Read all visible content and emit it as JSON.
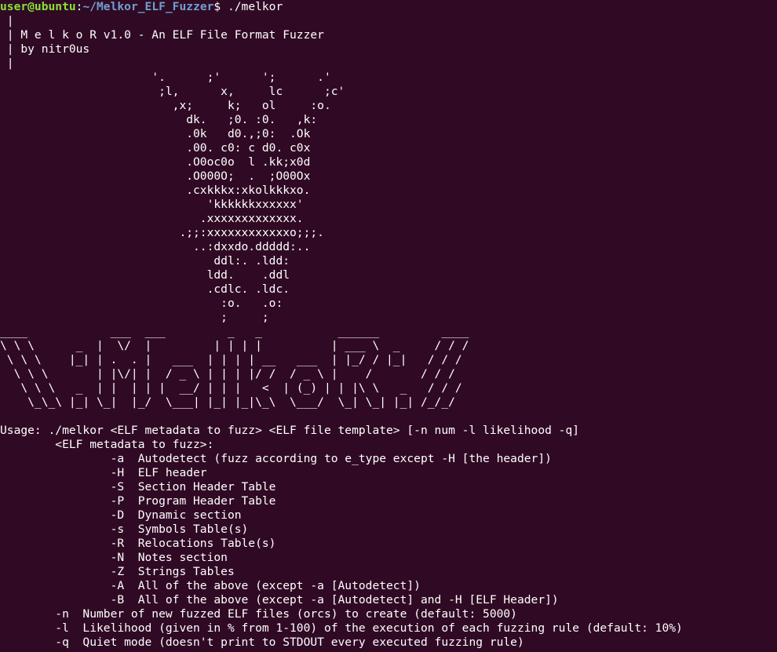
{
  "window": {
    "app": "Terminal"
  },
  "prompt": {
    "user_host": "user@ubuntu",
    "separator": ":",
    "path": "~/Melkor_ELF_Fuzzer",
    "symbol": "$ ",
    "command": "./melkor"
  },
  "colors": {
    "background": "#300a24",
    "text": "#ffffff",
    "prompt_user": "#8ae234",
    "prompt_path": "#729fcf"
  },
  "header_lines": [
    " |",
    " | M e l k o R v1.0 - An ELF File Format Fuzzer",
    " | by nitr0us",
    " |"
  ],
  "art_lines": [
    "                      '.      ;'      ';      .'",
    "                       ;l,      x,     lc      ;c'",
    "                         ,x;     k;   ol     :o.",
    "                           dk.   ;0. :0.   ,k:",
    "                           .0k   d0.,;0:  .Ok",
    "                           .00. c0: c d0. c0x",
    "                           .O0oc0o  l .kk;x0d",
    "                           .O000O;  .  ;O00Ox",
    "                           .cxkkkx:xkolkkkxo.",
    "                              'kkkkkkxxxxxx'",
    "                             .xxxxxxxxxxxxx.",
    "                          .;;:xxxxxxxxxxxxo;;;.",
    "                            ..:dxxdo.ddddd:..",
    "                               ddl:. .ldd:",
    "                              ldd.    .ddl",
    "                              .cdlc. .ldc.",
    "                                :o.   .o:",
    "                                ;     ;"
  ],
  "banner_lines": [
    "____            ___  ___         _   _           ______         ____",
    "\\ \\ \\      _  |  \\/  |         | | | |          | ___ \\  _     / / /",
    " \\ \\ \\    |_| | .  . |   ___  | | | | __   ___  | |_/ / |_|   / / /",
    "  \\ \\ \\       | |\\/| |  / _ \\ | | | |/ /  / _ \\ |    /       / / /",
    "   \\ \\ \\   _  | |  | | |  __/ | | |   <  | (_) | | |\\ \\   _   / / /",
    "    \\_\\_\\ |_| \\_|  |_/  \\___| |_| |_|\\_\\  \\___/  \\_| \\_| |_| /_/_/"
  ],
  "usage_lines": [
    "",
    "Usage: ./melkor <ELF metadata to fuzz> <ELF file template> [-n num -l likelihood -q]",
    "        <ELF metadata to fuzz>:",
    "                -a  Autodetect (fuzz according to e_type except -H [the header])",
    "                -H  ELF header",
    "                -S  Section Header Table",
    "                -P  Program Header Table",
    "                -D  Dynamic section",
    "                -s  Symbols Table(s)",
    "                -R  Relocations Table(s)",
    "                -N  Notes section",
    "                -Z  Strings Tables",
    "                -A  All of the above (except -a [Autodetect])",
    "                -B  All of the above (except -a [Autodetect] and -H [ELF Header])",
    "        -n  Number of new fuzzed ELF files (orcs) to create (default: 5000)",
    "        -l  Likelihood (given in % from 1-100) of the execution of each fuzzing rule (default: 10%)",
    "        -q  Quiet mode (doesn't print to STDOUT every executed fuzzing rule)"
  ]
}
